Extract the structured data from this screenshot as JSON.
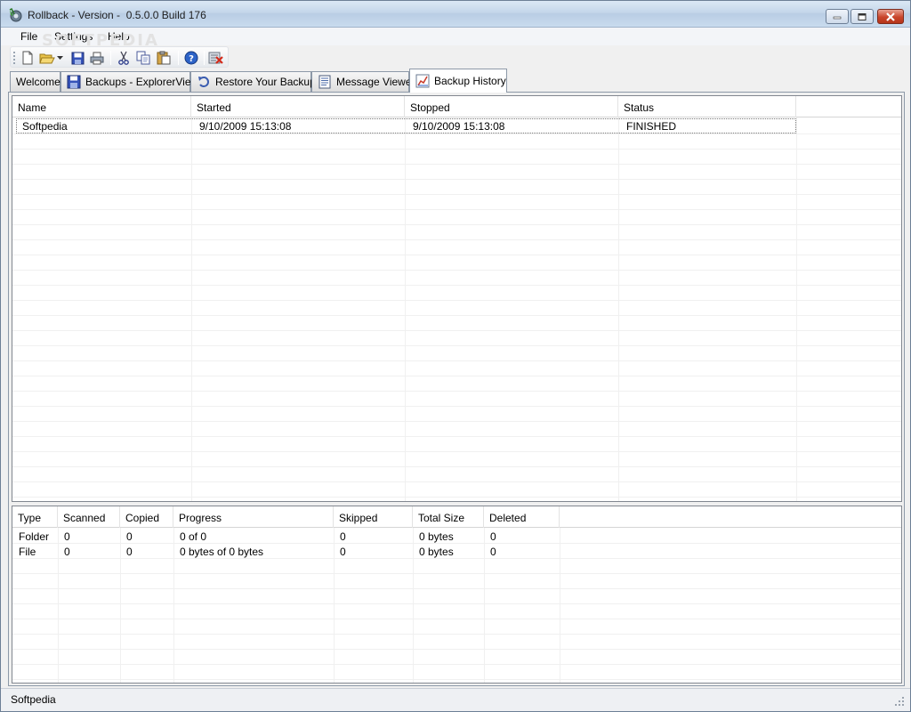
{
  "window": {
    "title": "Rollback - Version -  0.5.0.0 Build 176"
  },
  "menu": {
    "items": [
      "File",
      "Settings",
      "Help"
    ]
  },
  "watermark": "SOFTPEDIA",
  "tabs": [
    {
      "label": "Welcome",
      "icon": "none"
    },
    {
      "label": "Backups - ExplorerView",
      "icon": "floppy-icon"
    },
    {
      "label": "Restore Your Backup",
      "icon": "undo-icon"
    },
    {
      "label": "Message Viewer",
      "icon": "document-icon"
    },
    {
      "label": "Backup History",
      "icon": "chart-icon",
      "active": true
    }
  ],
  "history_table": {
    "columns": [
      "Name",
      "Started",
      "Stopped",
      "Status"
    ],
    "rows": [
      [
        "Softpedia",
        "9/10/2009  15:13:08",
        "9/10/2009  15:13:08",
        "FINISHED"
      ]
    ]
  },
  "details_table": {
    "columns": [
      "Type",
      "Scanned",
      "Copied",
      "Progress",
      "Skipped",
      "Total Size",
      "Deleted"
    ],
    "rows": [
      [
        "Folder",
        "0",
        "0",
        "0 of 0",
        "0",
        "0 bytes",
        "0"
      ],
      [
        "File",
        "0",
        "0",
        "0 bytes of 0 bytes",
        "0",
        "0 bytes",
        "0"
      ]
    ]
  },
  "statusbar": {
    "text": "Softpedia"
  },
  "colors": {
    "accent": "#b9cde4",
    "close_button": "#c9452c"
  }
}
